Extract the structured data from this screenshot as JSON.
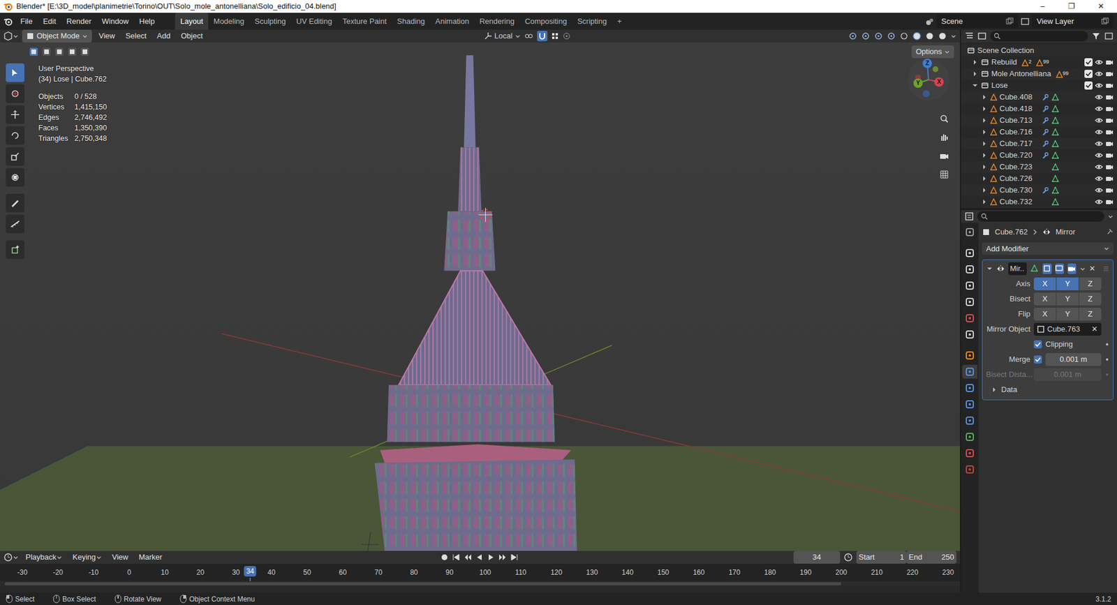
{
  "window": {
    "title": "Blender* [E:\\3D_model\\planimetrie\\Torino\\OUT\\Solo_mole_antonelliana\\Solo_edificio_04.blend]",
    "controls": [
      "–",
      "❐",
      "✕"
    ]
  },
  "menu": [
    "File",
    "Edit",
    "Render",
    "Window",
    "Help"
  ],
  "workspaces": [
    {
      "label": "Layout",
      "selected": true
    },
    {
      "label": "Modeling",
      "selected": false
    },
    {
      "label": "Sculpting",
      "selected": false
    },
    {
      "label": "UV Editing",
      "selected": false
    },
    {
      "label": "Texture Paint",
      "selected": false
    },
    {
      "label": "Shading",
      "selected": false
    },
    {
      "label": "Animation",
      "selected": false
    },
    {
      "label": "Rendering",
      "selected": false
    },
    {
      "label": "Compositing",
      "selected": false
    },
    {
      "label": "Scripting",
      "selected": false
    }
  ],
  "add_workspace": "+",
  "scene": "Scene",
  "view_layer": "View Layer",
  "viewport_header": {
    "mode": "Object Mode",
    "menus": [
      "View",
      "Select",
      "Add",
      "Object"
    ],
    "orientation": "Local",
    "options": "Options"
  },
  "tools": [
    {
      "selected": true
    },
    {
      "selected": false
    },
    {
      "selected": false
    },
    {
      "selected": false
    },
    {
      "selected": false
    },
    {
      "selected": false
    },
    {
      "selected": false
    },
    {
      "selected": false
    },
    {
      "selected": false
    }
  ],
  "viewport": {
    "perspective": "User Perspective",
    "context": "(34) Lose | Cube.762",
    "stats": [
      {
        "label": "Objects",
        "value": "0 / 528"
      },
      {
        "label": "Vertices",
        "value": "1,415,150"
      },
      {
        "label": "Edges",
        "value": "2,746,492"
      },
      {
        "label": "Faces",
        "value": "1,350,390"
      },
      {
        "label": "Triangles",
        "value": "2,750,348"
      }
    ]
  },
  "gizmo": [
    "X",
    "Y",
    "Z"
  ],
  "outliner": {
    "root": "Scene Collection",
    "collections": [
      {
        "name": "Rebuild",
        "expanded": false,
        "checked": true,
        "badges": [
          "2",
          "99"
        ]
      },
      {
        "name": "Mole Antonelliana",
        "expanded": false,
        "checked": true,
        "badges": [
          "99"
        ]
      },
      {
        "name": "Lose",
        "expanded": true,
        "checked": true,
        "badges": []
      }
    ],
    "objects": [
      {
        "name": "Cube.408",
        "expanded": false,
        "modifier": true
      },
      {
        "name": "Cube.418",
        "expanded": false,
        "modifier": true
      },
      {
        "name": "Cube.713",
        "expanded": false,
        "modifier": true
      },
      {
        "name": "Cube.716",
        "expanded": false,
        "modifier": true
      },
      {
        "name": "Cube.717",
        "expanded": false,
        "modifier": true
      },
      {
        "name": "Cube.720",
        "expanded": false,
        "modifier": true
      },
      {
        "name": "Cube.723",
        "expanded": false,
        "modifier": false
      },
      {
        "name": "Cube.726",
        "expanded": false,
        "modifier": false
      },
      {
        "name": "Cube.730",
        "expanded": false,
        "modifier": true
      },
      {
        "name": "Cube.732",
        "expanded": false,
        "modifier": false
      }
    ]
  },
  "properties": {
    "object": "Cube.762",
    "modifier": "Mirror",
    "add_modifier": "Add Modifier",
    "tabs": [
      {
        "selected": false,
        "color": "#9a9a9a"
      },
      {
        "selected": false,
        "color": "#d0d0d0"
      },
      {
        "selected": false,
        "color": "#d0d0d0"
      },
      {
        "selected": false,
        "color": "#d0d0d0"
      },
      {
        "selected": false,
        "color": "#d0d0d0"
      },
      {
        "selected": false,
        "color": "#d05050"
      },
      {
        "selected": false,
        "color": "#d0d0d0"
      },
      {
        "selected": false,
        "color": "#e3862b"
      },
      {
        "selected": true,
        "color": "#5b8fd8"
      },
      {
        "selected": false,
        "color": "#5b8fd8"
      },
      {
        "selected": false,
        "color": "#5b8fd8"
      },
      {
        "selected": false,
        "color": "#5b8fd8"
      },
      {
        "selected": false,
        "color": "#58b05a"
      },
      {
        "selected": false,
        "color": "#d05050"
      },
      {
        "selected": false,
        "color": "#c2463c"
      }
    ],
    "panel": {
      "name": "Mir..",
      "expanded": true,
      "toggles": [
        {
          "selected": false
        },
        {
          "selected": true
        },
        {
          "selected": true
        },
        {
          "selected": true
        }
      ],
      "close": "✕",
      "rows": [
        {
          "label": "Axis",
          "buttons": [
            {
              "label": "X",
              "selected": true
            },
            {
              "label": "Y",
              "selected": true
            },
            {
              "label": "Z",
              "selected": false
            }
          ]
        },
        {
          "label": "Bisect",
          "buttons": [
            {
              "label": "X",
              "selected": false
            },
            {
              "label": "Y",
              "selected": false
            },
            {
              "label": "Z",
              "selected": false
            }
          ]
        },
        {
          "label": "Flip",
          "buttons": [
            {
              "label": "X",
              "selected": false
            },
            {
              "label": "Y",
              "selected": false
            },
            {
              "label": "Z",
              "selected": false
            }
          ]
        }
      ],
      "mirror_object": {
        "label": "Mirror Object",
        "value": "Cube.763",
        "clear": "✕"
      },
      "clipping": {
        "label": "Clipping",
        "checked": true
      },
      "merge": {
        "label": "Merge",
        "checked": true,
        "value": "0.001 m"
      },
      "bisect_distance": {
        "label": "Bisect Dista...",
        "value": "0.001 m",
        "disabled": true
      },
      "data": {
        "label": "Data",
        "expanded": false
      }
    }
  },
  "timeline": {
    "menus": [
      "Playback",
      "Keying",
      "View",
      "Marker"
    ],
    "frame": "34",
    "start_label": "Start",
    "start": "1",
    "end_label": "End",
    "end": "250",
    "playhead": "34",
    "ticks": [
      "-30",
      "-20",
      "-10",
      "0",
      "10",
      "20",
      "30",
      "40",
      "50",
      "60",
      "70",
      "80",
      "90",
      "100",
      "110",
      "120",
      "130",
      "140",
      "150",
      "160",
      "170",
      "180",
      "190",
      "200",
      "210",
      "220",
      "230"
    ]
  },
  "status": {
    "items": [
      "Select",
      "Box Select",
      "Rotate View",
      "Object Context Menu"
    ],
    "version": "3.1.2"
  }
}
